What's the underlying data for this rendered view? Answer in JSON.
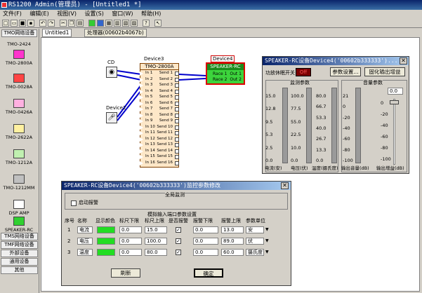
{
  "window": {
    "title": "RS1200  Admin(管理员) - [Untitled1 *]"
  },
  "menu": [
    "文件(F)",
    "编辑(E)",
    "视图(V)",
    "设置(S)",
    "窗口(W)",
    "帮助(H)"
  ],
  "left_panel": {
    "header": "TMO网络设备",
    "devices": [
      {
        "label": "TMO-2424",
        "color": "#b0e8b0"
      },
      {
        "label": "TMO-2800A",
        "color": "#ff33cc"
      },
      {
        "label": "TMO-0028A",
        "color": "#ff4444"
      },
      {
        "label": "TMO-0426A",
        "color": "#ffb0e0"
      },
      {
        "label": "TMO-2622A",
        "color": "#fff0a0"
      },
      {
        "label": "TMO-1212A",
        "color": "#c0f0b0"
      },
      {
        "label": "TMO-1212MM",
        "color": "#c0c0c0"
      },
      {
        "label": "DSP AMP",
        "color": "#ffffff"
      },
      {
        "label": "SPEAKER-RC",
        "color": "#30d030"
      }
    ],
    "bottom_buttons": [
      "TMS网络设备",
      "TMF网络设备",
      "外部设备",
      "通用设备",
      "其他"
    ]
  },
  "tabs": [
    "Untitled1",
    "处理器(00602b4067b)"
  ],
  "canvas": {
    "cd_label": "CD",
    "device2_label": "Device2",
    "device3": {
      "caption": "Device3",
      "model": "TMO-2800A",
      "inputs": [
        "In 1",
        "In 2",
        "In 3",
        "In 4",
        "In 5",
        "In 6",
        "In 7",
        "In 8",
        "In 9",
        "In 10",
        "In 11",
        "In 12",
        "In 13",
        "In 14",
        "In 15",
        "In 16"
      ],
      "outputs": [
        "Send 1",
        "Send 2",
        "Send 3",
        "Send 4",
        "Send 5",
        "Send 6",
        "Send 7",
        "Send 8",
        "Send 9",
        "Send 10",
        "Send 11",
        "Send 12",
        "Send 13",
        "Send 14",
        "Send 15",
        "Send 16"
      ]
    },
    "device4": {
      "caption": "Device4",
      "model": "SPEAKER-RC",
      "inputs": [
        "Race 1",
        "Race 2"
      ],
      "outputs": [
        "Out 1",
        "Out 2"
      ]
    }
  },
  "speaker_panel": {
    "title": "SPEAKER-RC设备Device4('00602b333333')...",
    "amp_switch_label": "功放休眠开关：",
    "amp_switch_value": "Off",
    "param_btn": "参数设置...",
    "fix_gain_btn": "固化输出增益",
    "monitor_group": "监测参数",
    "volume_group": "音量参数",
    "volume_value": "0.0",
    "col1_ticks": [
      "15.0",
      "12.8",
      "9.5",
      "5.3",
      "2.5",
      "0.0"
    ],
    "col2_ticks": [
      "100.0",
      "77.5",
      "55.0",
      "22.5",
      "10.0",
      "0.0"
    ],
    "col3_ticks": [
      "80.0",
      "66.7",
      "53.3",
      "40.0",
      "26.7",
      "13.3",
      "0.0"
    ],
    "col4_ticks": [
      "21",
      "0",
      "-20",
      "-40",
      "-60",
      "-80",
      "-100"
    ],
    "col5_ticks": [
      "0",
      "-20",
      "-40",
      "-60",
      "-80",
      "-100"
    ],
    "col1_label": "电流(安)",
    "col2_label": "电压(伏)",
    "col3_label": "温度(摄氏度)",
    "col4_label": "输出音量(dB)",
    "col5_label": "输出增益(dB)"
  },
  "monitor_dialog": {
    "title": "SPEAKER-RC设备Device4('00602b333333')监控参数修改",
    "global_label": "全局监测",
    "alarm_label": "启动报警",
    "section_label": "模拟输入端口参数设置",
    "headers": [
      "序号",
      "名称",
      "显示颜色",
      "标尺下限",
      "标尺上限",
      "是否报警",
      "报警下限",
      "报警上限",
      "参数单位"
    ],
    "rows": [
      {
        "no": "1",
        "name": "电流",
        "low": "0.0",
        "high": "15.0",
        "alarm": "✓",
        "alarm_low": "0.0",
        "alarm_high": "13.0",
        "unit": "安"
      },
      {
        "no": "2",
        "name": "电压",
        "low": "0.0",
        "high": "100.0",
        "alarm": "✓",
        "alarm_low": "0.0",
        "alarm_high": "89.0",
        "unit": "伏"
      },
      {
        "no": "3",
        "name": "温度",
        "low": "0.0",
        "high": "80.0",
        "alarm": "✓",
        "alarm_low": "0.0",
        "alarm_high": "60.0",
        "unit": "摄氏度"
      }
    ],
    "refresh_btn": "刷新",
    "ok_btn": "确定"
  }
}
